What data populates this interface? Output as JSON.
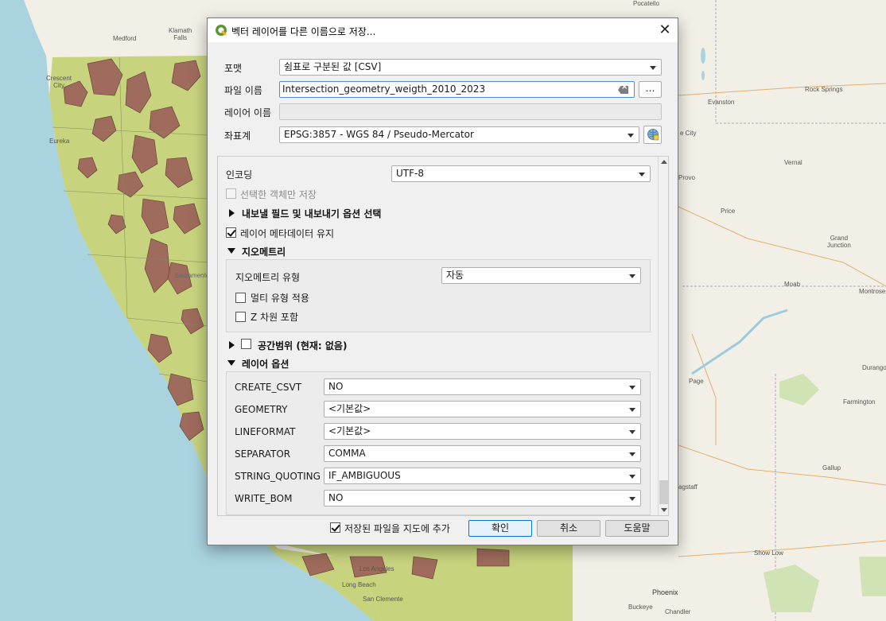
{
  "map": {
    "labels": [
      {
        "text": "Medford",
        "key": "medford"
      },
      {
        "text": "Klamath\nFalls",
        "key": "klamath"
      },
      {
        "text": "Crescent\nCity",
        "key": "crescent"
      },
      {
        "text": "Eureka",
        "key": "eureka"
      },
      {
        "text": "Pocatello",
        "key": "pocatello"
      },
      {
        "text": "Evanston",
        "key": "evanston"
      },
      {
        "text": "Rock Springs",
        "key": "rocksprings"
      },
      {
        "text": "e City",
        "key": "ecity"
      },
      {
        "text": "Provo",
        "key": "provo"
      },
      {
        "text": "Vernal",
        "key": "vernal"
      },
      {
        "text": "Price",
        "key": "price"
      },
      {
        "text": "Grand\nJunction",
        "key": "grandjunction"
      },
      {
        "text": "Moab",
        "key": "moab"
      },
      {
        "text": "Montrose",
        "key": "montrose"
      },
      {
        "text": "Durango",
        "key": "durango"
      },
      {
        "text": "Page",
        "key": "page"
      },
      {
        "text": "Farmington",
        "key": "farmington"
      },
      {
        "text": "Gallup",
        "key": "gallup"
      },
      {
        "text": "agstaff",
        "key": "flagstaff"
      },
      {
        "text": "Show Low",
        "key": "showlow"
      },
      {
        "text": "Phoenix",
        "key": "phoenix"
      },
      {
        "text": "Buckeye",
        "key": "buckeye"
      },
      {
        "text": "Chandler",
        "key": "chandler"
      },
      {
        "text": "Sacramento",
        "key": "sacramento"
      },
      {
        "text": "Long Beach",
        "key": "longbeach"
      },
      {
        "text": "San Clemente",
        "key": "sanclemente"
      },
      {
        "text": "Los Angeles",
        "key": "losangeles"
      }
    ],
    "colors": {
      "ocean": "#a9d3df",
      "land": "#f2efe6",
      "region": "#c8d37e",
      "polygon": "#9e6b5c"
    }
  },
  "dialog": {
    "title": "벡터 레이어를 다른 이름으로 저장...",
    "close_glyph": "✕",
    "format_label": "포맷",
    "format_value": "쉼표로 구분된 값 [CSV]",
    "filename_label": "파일 이름",
    "filename_value": "Intersection_geometry_weigth_2010_2023",
    "browse_label": "…",
    "layername_label": "레이어 이름",
    "crs_label": "좌표계",
    "crs_value": "EPSG:3857 - WGS 84 / Pseudo-Mercator",
    "encoding_label": "인코딩",
    "encoding_value": "UTF-8",
    "selected_only_label": "선택한 객체만 저장",
    "fields_section": "내보낼 필드 및 내보내기 옵션 선택",
    "keep_metadata_label": "레이어 메타데이터 유지",
    "geometry_section": "지오메트리",
    "geometry_type_label": "지오메트리 유형",
    "geometry_type_value": "자동",
    "multi_type_label": "멀티 유형 적용",
    "z_dim_label": "Z 차원 포함",
    "extent_section": "공간범위 (현재: 없음)",
    "layer_options_section": "레이어 옵션",
    "layer_options": [
      {
        "key": "CREATE_CSVT",
        "value": "NO"
      },
      {
        "key": "GEOMETRY",
        "value": "<기본값>"
      },
      {
        "key": "LINEFORMAT",
        "value": "<기본값>"
      },
      {
        "key": "SEPARATOR",
        "value": "COMMA"
      },
      {
        "key": "STRING_QUOTING",
        "value": "IF_AMBIGUOUS"
      },
      {
        "key": "WRITE_BOM",
        "value": "NO"
      }
    ],
    "add_to_map_label": "저장된 파일을 지도에 추가",
    "ok_label": "확인",
    "cancel_label": "취소",
    "help_label": "도움말"
  }
}
